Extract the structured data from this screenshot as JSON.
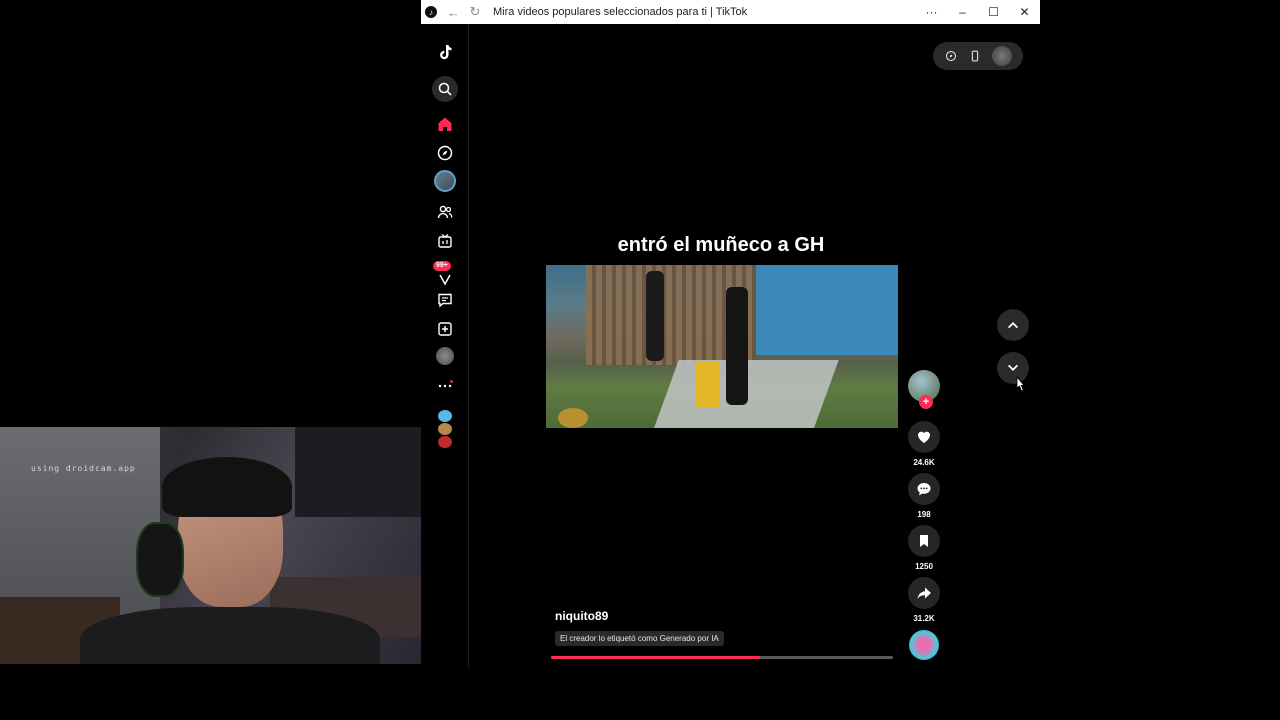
{
  "window": {
    "title": "Mira videos populares seleccionados para ti | TikTok",
    "more": "···",
    "minimize": "–",
    "maximize": "☐",
    "close": "✕"
  },
  "sidebar": {
    "notification_badge": "99+",
    "active_color": "#fe2c55"
  },
  "video": {
    "caption": "entró el muñeco a GH",
    "username": "niquito89",
    "ai_label": "El creador lo etiquetó como Generado por IA",
    "progress": 0.61
  },
  "actions": {
    "likes": "24.6K",
    "comments": "198",
    "bookmarks": "1250",
    "shares": "31.2K",
    "follow": "+"
  },
  "webcam": {
    "label": "using droidcam.app"
  }
}
